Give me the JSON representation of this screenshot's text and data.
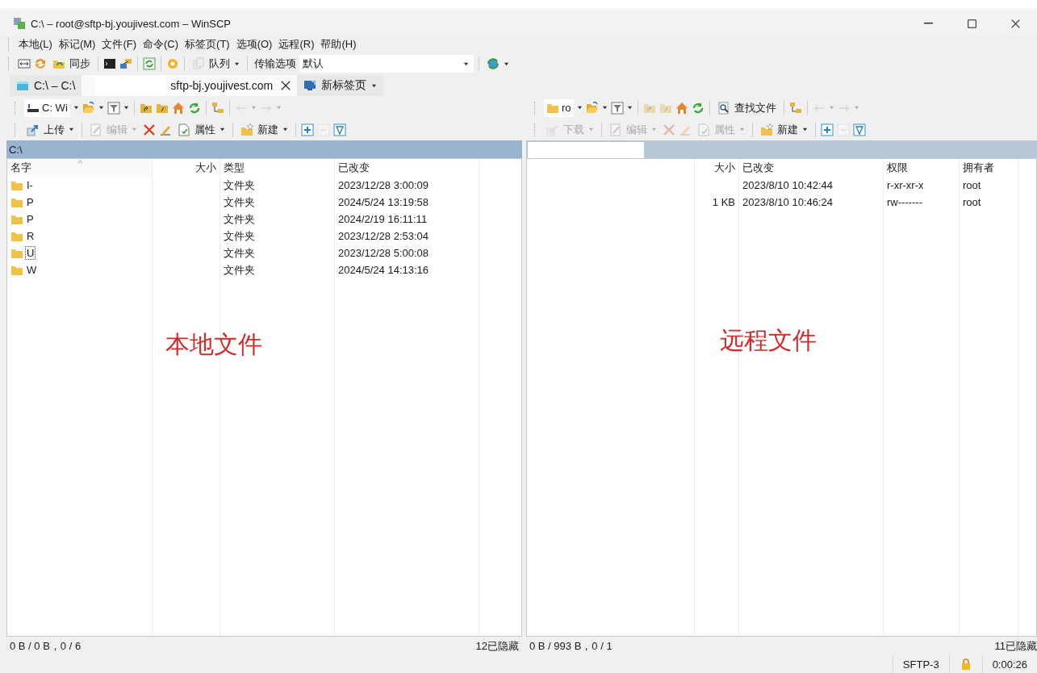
{
  "window": {
    "title": "C:\\ – root@sftp-bj.youjivest.com – WinSCP"
  },
  "menu": [
    {
      "label": "本地(L)"
    },
    {
      "label": "标记(M)"
    },
    {
      "label": "文件(F)"
    },
    {
      "label": "命令(C)"
    },
    {
      "label": "标签页(T)"
    },
    {
      "label": "选项(O)"
    },
    {
      "label": "远程(R)"
    },
    {
      "label": "帮助(H)"
    }
  ],
  "toolbar": {
    "sync_label": "同步",
    "queue_label": "队列",
    "transfer_label": "传输选项",
    "transfer_value": "默认"
  },
  "tabs": [
    {
      "label": "C:\\ – C:\\",
      "selected": false,
      "redacted": false,
      "closable": false
    },
    {
      "label": "sftp-bj.youjivest.com",
      "selected": true,
      "redacted": true,
      "closable": true
    },
    {
      "label": "新标签页",
      "selected": false,
      "redacted": false,
      "closable": false,
      "kind": "new"
    }
  ],
  "panels": [
    {
      "kind": "local",
      "active": true,
      "location": {
        "kind": "drive",
        "label": "C: Wi"
      },
      "path": "C:\\",
      "path_redacted": false,
      "actions": [
        {
          "kind": "upload",
          "label": "上传",
          "disabled": false
        },
        {
          "kind": "edit",
          "label": "编辑",
          "disabled": true
        },
        {
          "kind": "delete",
          "disabled": false
        },
        {
          "kind": "rename",
          "disabled": false
        },
        {
          "kind": "properties",
          "label": "属性",
          "disabled": false
        },
        {
          "kind": "new",
          "label": "新建",
          "disabled": false
        }
      ],
      "columns": [
        {
          "label": "名字",
          "sorted": true
        },
        {
          "label": "大小",
          "sorted": false
        },
        {
          "label": "类型",
          "sorted": false
        },
        {
          "label": "已改变",
          "sorted": false
        }
      ],
      "rows": [
        {
          "cells": [
            "I-",
            null,
            "文件夹",
            "2023/12/28 3:00:09"
          ],
          "focused": false
        },
        {
          "cells": [
            "P",
            null,
            "文件夹",
            "2024/5/24 13:19:58"
          ],
          "focused": false
        },
        {
          "cells": [
            "P",
            null,
            "文件夹",
            "2024/2/19 16:11:11"
          ],
          "focused": false
        },
        {
          "cells": [
            "R",
            null,
            "文件夹",
            "2023/12/28 2:53:04"
          ],
          "focused": false
        },
        {
          "cells": [
            "U",
            null,
            "文件夹",
            "2023/12/28 5:00:08"
          ],
          "focused": true
        },
        {
          "cells": [
            "W",
            null,
            "文件夹",
            "2024/5/24 14:13:16"
          ],
          "focused": false
        }
      ],
      "annotation": "本地文件",
      "status": "0 B / 0 B，0 / 6",
      "hidden": "12已隐藏"
    },
    {
      "kind": "remote",
      "active": false,
      "location": {
        "kind": "folder",
        "label": "ro"
      },
      "find_label": "查找文件",
      "path_redacted": true,
      "actions": [
        {
          "kind": "download",
          "label": "下载",
          "disabled": true
        },
        {
          "kind": "edit",
          "label": "编辑",
          "disabled": true
        },
        {
          "kind": "delete",
          "disabled": true
        },
        {
          "kind": "rename",
          "disabled": true
        },
        {
          "kind": "properties",
          "label": "属性",
          "disabled": true
        },
        {
          "kind": "new",
          "label": "新建",
          "disabled": false
        }
      ],
      "columns": [
        {
          "label": "大小",
          "sorted": false
        },
        {
          "label": "已改变",
          "sorted": false
        },
        {
          "label": "权限",
          "sorted": false
        },
        {
          "label": "拥有者",
          "sorted": false
        }
      ],
      "rows": [
        {
          "cells": [
            null,
            "2023/8/10 10:42:44",
            "r-xr-xr-x",
            "root"
          ]
        },
        {
          "cells": [
            "1 KB",
            "2023/8/10 10:46:24",
            "rw-------",
            "root"
          ]
        }
      ],
      "annotation": "远程文件",
      "status": "0 B / 993 B，0 / 1",
      "hidden": "11已隐藏"
    }
  ],
  "status_bar": {
    "protocol": "SFTP-3",
    "elapsed": "0:00:26"
  }
}
